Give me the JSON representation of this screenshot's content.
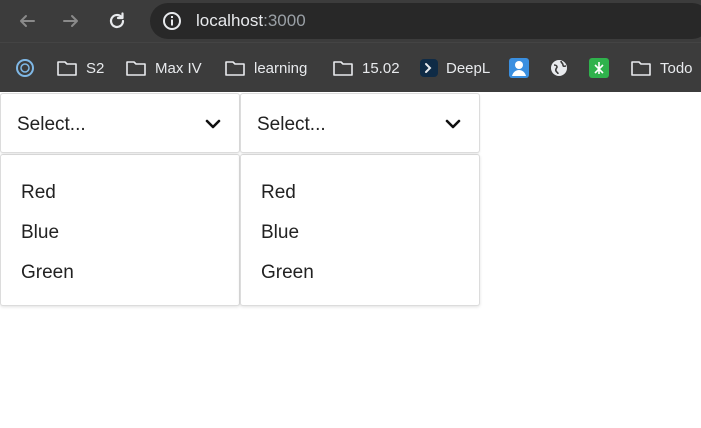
{
  "browser": {
    "url_host": "localhost",
    "url_port": ":3000",
    "toolbar_icons": [
      "back-arrow-icon",
      "forward-arrow-icon",
      "reload-icon",
      "info-icon"
    ]
  },
  "bookmarks": [
    {
      "label": "",
      "icon": "circle-app-icon"
    },
    {
      "label": "S2",
      "icon": "folder-icon"
    },
    {
      "label": "Max IV",
      "icon": "folder-icon"
    },
    {
      "label": "learning",
      "icon": "folder-icon"
    },
    {
      "label": "15.02",
      "icon": "folder-icon"
    },
    {
      "label": "DeepL",
      "icon": "deepl-icon"
    },
    {
      "label": "",
      "icon": "avatar-app-icon"
    },
    {
      "label": "",
      "icon": "globe-icon"
    },
    {
      "label": "",
      "icon": "green-app-icon"
    },
    {
      "label": "Todo",
      "icon": "folder-icon"
    }
  ],
  "selects": [
    {
      "placeholder": "Select...",
      "options": [
        "Red",
        "Blue",
        "Green"
      ]
    },
    {
      "placeholder": "Select...",
      "options": [
        "Red",
        "Blue",
        "Green"
      ]
    }
  ],
  "colors": {
    "chrome_bg": "#3c3c3c",
    "omnibox_bg": "#282828",
    "text_light": "#e8eaed",
    "border": "#dcdcdc"
  }
}
